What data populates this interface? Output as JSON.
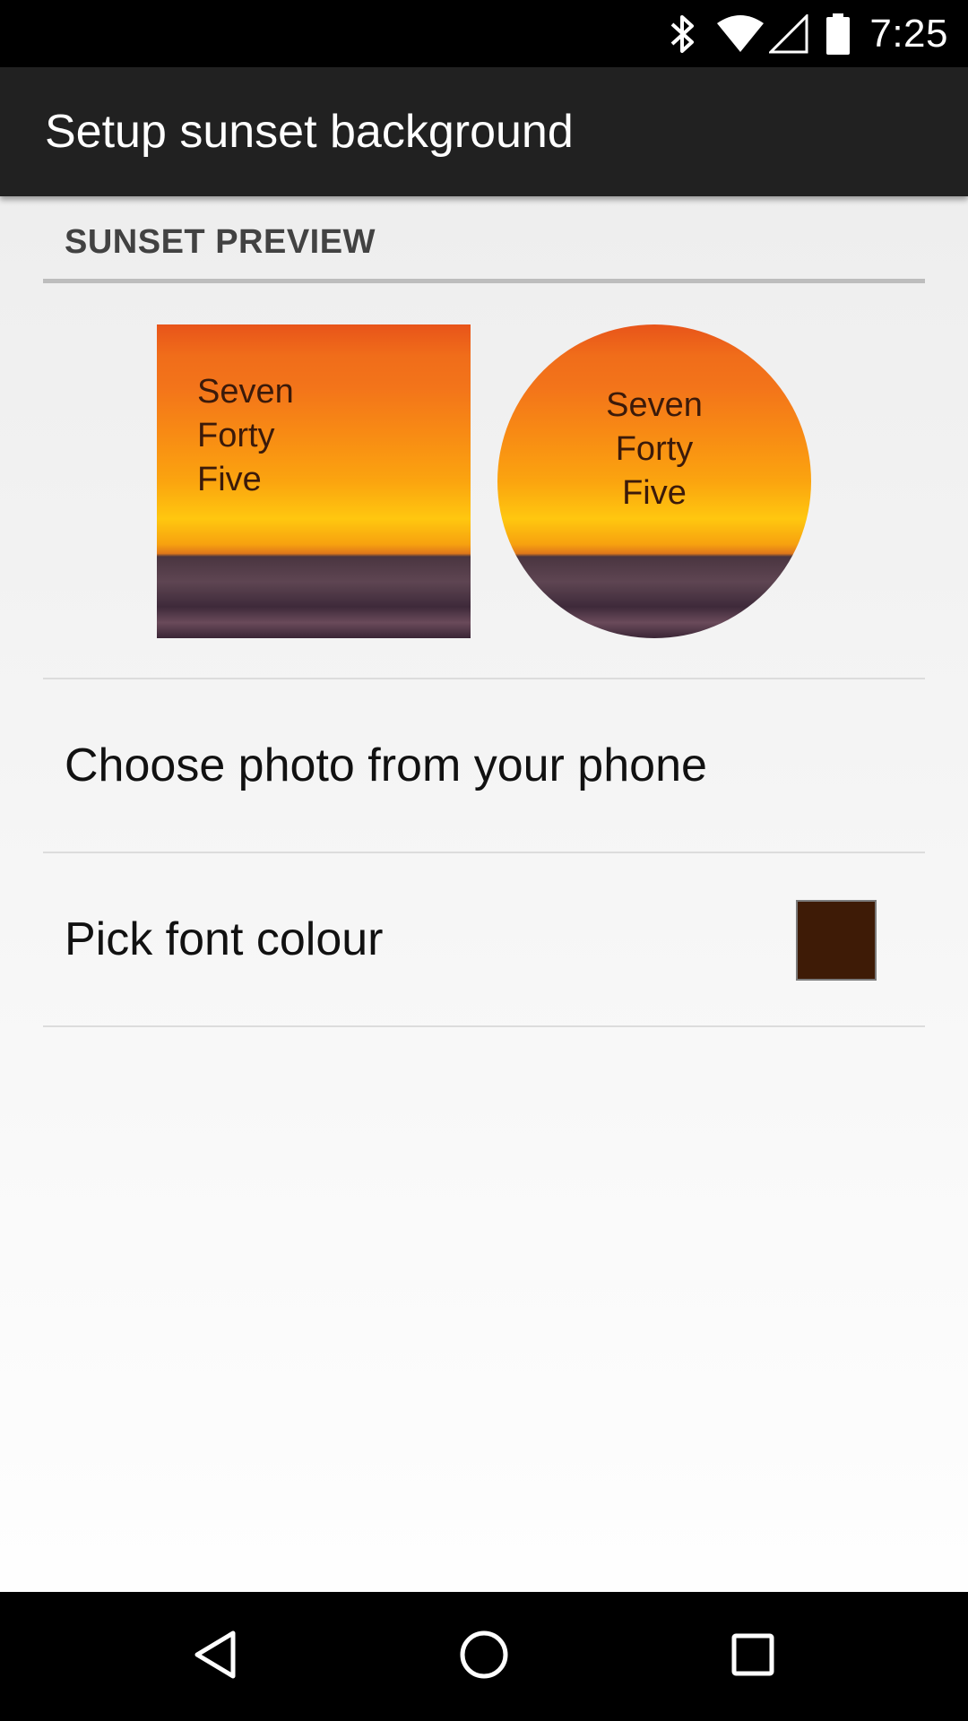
{
  "status_bar": {
    "time": "7:25",
    "icons": [
      "bluetooth-icon",
      "wifi-icon",
      "cell-signal-icon",
      "battery-icon"
    ]
  },
  "app_bar": {
    "title": "Setup sunset background"
  },
  "section": {
    "header": "SUNSET PREVIEW"
  },
  "preview": {
    "square_text": [
      "Seven",
      "Forty",
      "Five"
    ],
    "round_text": [
      "Seven",
      "Forty",
      "Five"
    ]
  },
  "settings": {
    "choose_photo_label": "Choose photo from your phone",
    "font_colour_label": "Pick font colour",
    "font_colour": "#3e1b06"
  },
  "nav_bar": {
    "buttons": [
      "back-icon",
      "home-icon",
      "recents-icon"
    ]
  },
  "colors": {
    "app_bar": "#212121",
    "status_bar": "#000000",
    "section_rule": "#bdbdbd"
  }
}
